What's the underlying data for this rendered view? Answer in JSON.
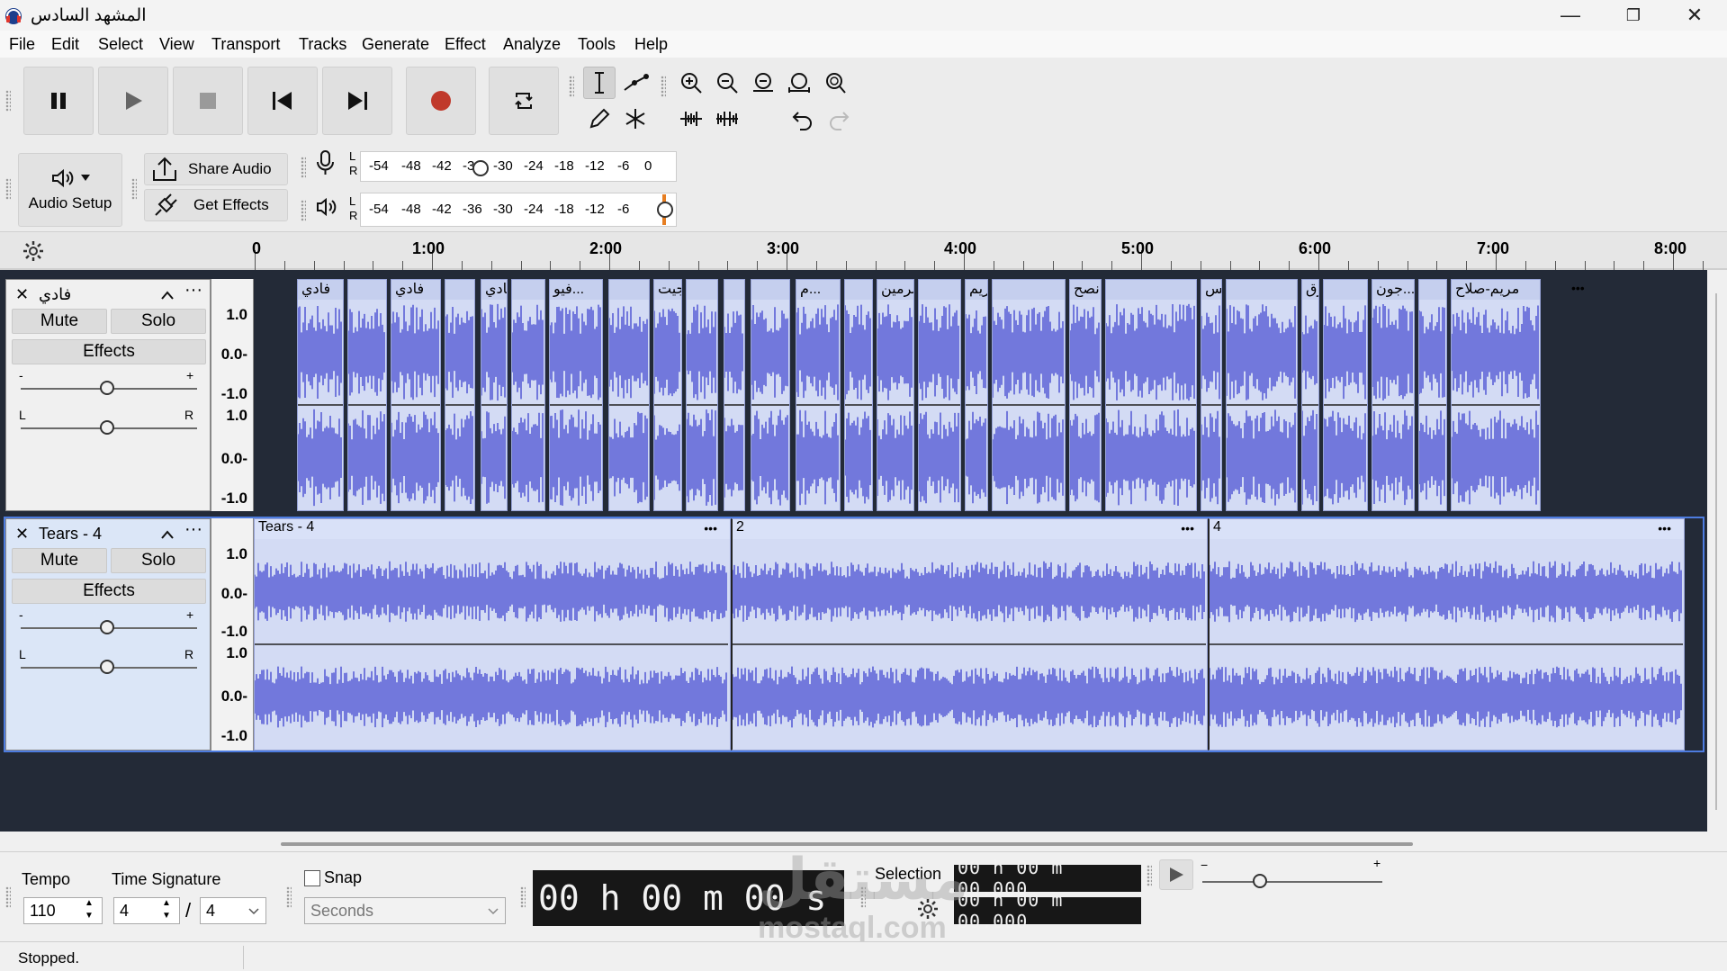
{
  "window": {
    "title": "المشهد السادس",
    "min_glyph": "—",
    "max_glyph": "❐",
    "close_glyph": "✕"
  },
  "menu": [
    "File",
    "Edit",
    "Select",
    "View",
    "Transport",
    "Tracks",
    "Generate",
    "Effect",
    "Analyze",
    "Tools",
    "Help"
  ],
  "toolbar": {
    "audio_setup_label": "Audio Setup",
    "share_audio_label": "Share Audio",
    "get_effects_label": "Get Effects",
    "record_meter_scale": [
      "-54",
      "-48",
      "-42",
      "-36",
      "-30",
      "-24",
      "-18",
      "-12",
      "-6",
      "0"
    ],
    "play_meter_scale": [
      "-54",
      "-48",
      "-42",
      "-36",
      "-30",
      "-24",
      "-18",
      "-12",
      "-6"
    ],
    "lr": [
      "L",
      "R"
    ]
  },
  "ruler": {
    "labels": [
      "0",
      "1:00",
      "2:00",
      "3:00",
      "4:00",
      "5:00",
      "6:00",
      "7:00",
      "8:00"
    ]
  },
  "tracks": [
    {
      "name": "فادي",
      "mute_label": "Mute",
      "solo_label": "Solo",
      "effects_label": "Effects",
      "gain_minus": "-",
      "gain_plus": "+",
      "pan_left": "L",
      "pan_right": "R",
      "scale": [
        "1.0",
        "0.0-",
        "-1.0",
        "1.0",
        "0.0-",
        "-1.0"
      ],
      "clips": [
        "فادي",
        "",
        "فادي",
        "",
        "فادي",
        "",
        "فيو...",
        "",
        "جورجيت",
        "",
        "",
        "",
        "م...",
        "",
        "نرمين",
        "",
        "مريم...",
        "",
        "نصح...",
        "",
        "كيرلس...",
        "",
        "مرق...",
        "",
        "جون...",
        "",
        "مريم-صلاح"
      ]
    },
    {
      "name": "Tears - 4",
      "mute_label": "Mute",
      "solo_label": "Solo",
      "effects_label": "Effects",
      "gain_minus": "-",
      "gain_plus": "+",
      "pan_left": "L",
      "pan_right": "R",
      "scale": [
        "1.0",
        "0.0-",
        "-1.0",
        "1.0",
        "0.0-",
        "-1.0"
      ],
      "clips": [
        "Tears - 4",
        "2",
        "4"
      ]
    }
  ],
  "bottom": {
    "tempo_label": "Tempo",
    "tempo_value": "110",
    "time_sig_label": "Time Signature",
    "time_sig_num": "4",
    "time_sig_sep": "/",
    "time_sig_den": "4",
    "snap_label": "Snap",
    "snap_unit": "Seconds",
    "time_display": "00 h 00 m 00 s",
    "selection_label": "Selection",
    "sel_start": "00 h 00 m 00.000",
    "sel_end": "00 h 00 m 00.000"
  },
  "status": "Stopped.",
  "watermark": {
    "ar": "مستقل",
    "en": "mostaql.com"
  },
  "colors": {
    "waveform": "#5a5fd6",
    "clip_bg": "#d3dbf4",
    "tracks_bg": "#232a37",
    "record": "#c0392b"
  }
}
